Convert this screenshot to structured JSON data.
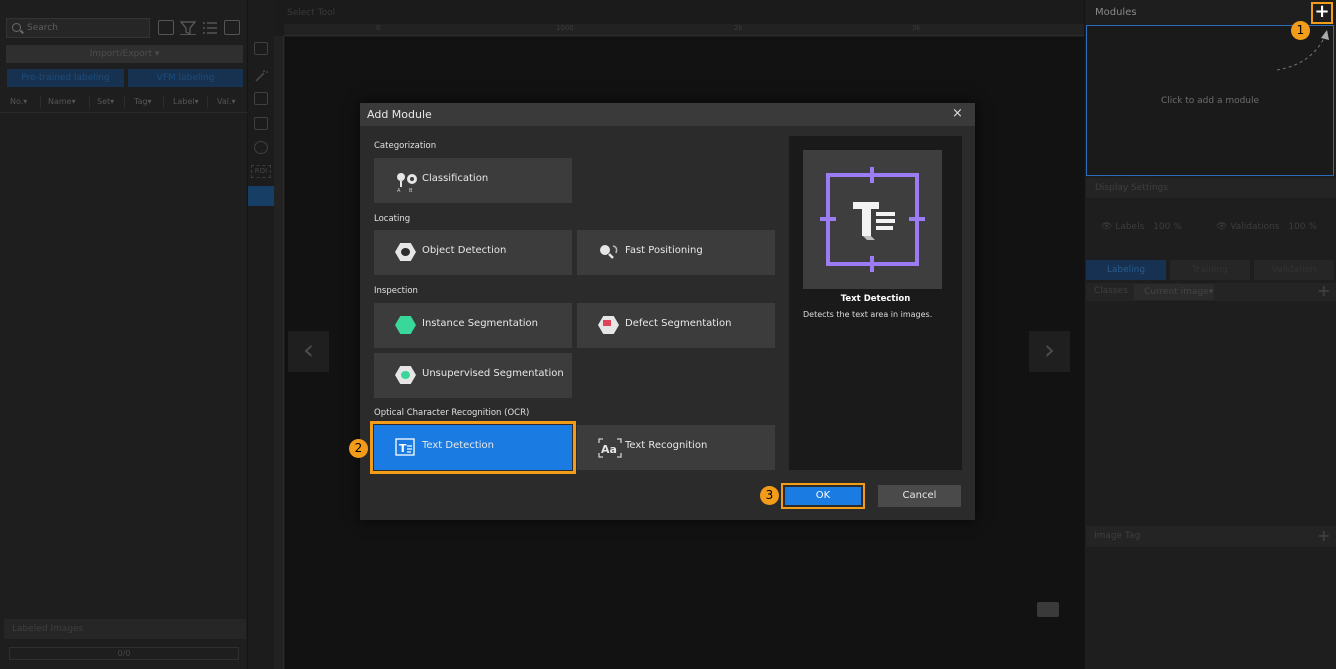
{
  "left_panel": {
    "search_placeholder": "Search",
    "import_export_label": "Import/Export ▾",
    "pretrained_label": "Pre-trained labeling",
    "vfm_label": "VFM labeling",
    "columns": [
      "No.▾",
      "Name▾",
      "Set▾",
      "Tag▾",
      "Label▾",
      "Val.▾"
    ],
    "labeled_images_label": "Labeled Images",
    "progress_text": "0/0"
  },
  "tool_strip": {
    "roi_label": "ROI"
  },
  "canvas": {
    "select_tool_label": "Select Tool",
    "ruler_ticks": [
      "0",
      "1000",
      "2k",
      "3k",
      "4k"
    ],
    "prev_arrow": "‹",
    "next_arrow": "›"
  },
  "right_panel": {
    "modules_title": "Modules",
    "add_module_plus": "+",
    "click_to_add": "Click to add a module",
    "display_settings_label": "Display Settings",
    "labels_text": "Labels",
    "labels_pct": "100 %",
    "validations_text": "Validations",
    "validations_pct": "100 %",
    "tabs": [
      "Labeling",
      "Training",
      "Validation"
    ],
    "classes_label": "Classes",
    "current_image_dropdown": "Current image▾",
    "image_tag_label": "Image Tag",
    "plus_symbol": "+"
  },
  "dialog": {
    "title": "Add Module",
    "close_symbol": "×",
    "sections": {
      "categorization": "Categorization",
      "locating": "Locating",
      "inspection": "Inspection",
      "ocr": "Optical Character Recognition (OCR)"
    },
    "modules": {
      "classification": "Classification",
      "object_detection": "Object Detection",
      "fast_positioning": "Fast Positioning",
      "instance_segmentation": "Instance Segmentation",
      "defect_segmentation": "Defect Segmentation",
      "unsupervised_segmentation": "Unsupervised Segmentation",
      "text_detection": "Text Detection",
      "text_recognition": "Text Recognition"
    },
    "preview": {
      "title": "Text Detection",
      "description": "Detects the text area in images."
    },
    "ok_label": "OK",
    "cancel_label": "Cancel",
    "accent_color": "#1a7be2"
  },
  "callouts": {
    "step1": "1",
    "step2": "2",
    "step3": "3",
    "color": "#f39c1a"
  }
}
